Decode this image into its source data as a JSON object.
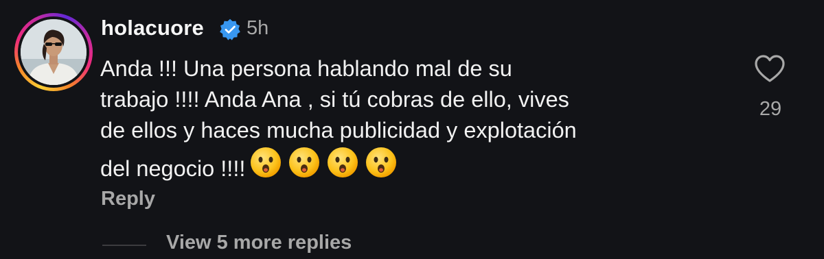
{
  "comment": {
    "username": "holacuore",
    "verified": true,
    "time": "5h",
    "text": "Anda !!! Una persona hablando mal de su\ntrabajo !!!! Anda Ana , si tú cobras de ello, vives\nde ellos y haces mucha publicidad y explotación\ndel negocio !!!!",
    "emojis": [
      "hushed-face",
      "hushed-face",
      "hushed-face",
      "hushed-face"
    ],
    "reply_label": "Reply",
    "like_count": "29",
    "view_replies_label": "View 5 more replies"
  },
  "icons": {
    "verified": "verified-badge-icon",
    "like": "heart-outline-icon",
    "emoji": "hushed-face-emoji"
  },
  "colors": {
    "background": "#121317",
    "text": "#f2f2f2",
    "secondary": "#a8a8a8",
    "verified": "#3897f0"
  }
}
